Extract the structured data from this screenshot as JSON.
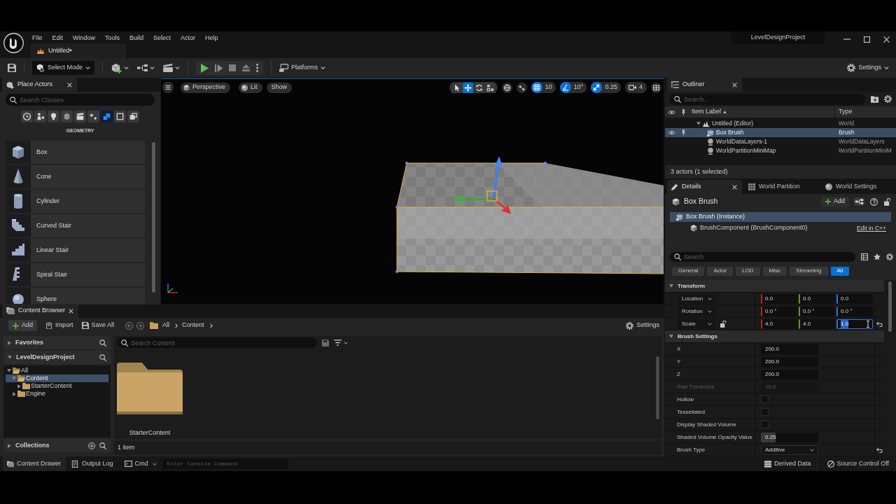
{
  "title_bar": {
    "menu": [
      "File",
      "Edit",
      "Window",
      "Tools",
      "Build",
      "Select",
      "Actor",
      "Help"
    ],
    "document_tab": "Untitled•",
    "project": "LevelDesignProject"
  },
  "toolbar": {
    "mode": "Select Mode",
    "platforms": "Platforms",
    "settings": "Settings"
  },
  "place_actors": {
    "title": "Place Actors",
    "search": {
      "placeholder": "Search Classes"
    },
    "categories": [
      {
        "kind": "recent",
        "selected": false
      },
      {
        "kind": "basic",
        "selected": false
      },
      {
        "kind": "lights",
        "selected": false
      },
      {
        "kind": "shapes",
        "selected": false
      },
      {
        "kind": "cinematic",
        "selected": false
      },
      {
        "kind": "effects",
        "selected": false
      },
      {
        "kind": "geometry",
        "selected": true
      },
      {
        "kind": "volumes",
        "selected": false
      },
      {
        "kind": "all_classes",
        "selected": false
      }
    ],
    "category_title": "GEOMETRY",
    "items": [
      {
        "kind": "box",
        "label": "Box"
      },
      {
        "kind": "cone",
        "label": "Cone"
      },
      {
        "kind": "cylinder",
        "label": "Cylinder"
      },
      {
        "kind": "curved_stair",
        "label": "Curved Stair"
      },
      {
        "kind": "linear_stair",
        "label": "Linear Stair"
      },
      {
        "kind": "spiral_stair",
        "label": "Spiral Stair"
      },
      {
        "kind": "sphere",
        "label": "Sphere"
      }
    ]
  },
  "viewport": {
    "view": "Perspective",
    "lighting": "Lit",
    "show": "Show",
    "tools": [
      {
        "kind": "select",
        "selected": false
      },
      {
        "kind": "translate",
        "selected": true
      },
      {
        "kind": "rotate",
        "selected": false
      },
      {
        "kind": "scale",
        "selected": false
      }
    ],
    "snaps": [
      {
        "kind": "grid",
        "on": true,
        "value": "10"
      },
      {
        "kind": "angle",
        "on": true,
        "value": "10°"
      },
      {
        "kind": "scale",
        "on": true,
        "value": "0.25"
      }
    ],
    "camera_speed": "4"
  },
  "content_browser": {
    "title": "Content Browser",
    "actions": [
      {
        "kind": "add",
        "label": "Add"
      },
      {
        "kind": "import",
        "label": "Import"
      },
      {
        "kind": "save_all",
        "label": "Save All"
      }
    ],
    "path": [
      "All",
      "Content"
    ],
    "settings": "Settings",
    "favorites": "Favorites",
    "project": "LevelDesignProject",
    "tree": [
      {
        "label": "All",
        "expanded": true,
        "selected": false,
        "children": [
          {
            "label": "Content",
            "expanded": true,
            "selected": true,
            "children": [
              {
                "label": "StarterContent",
                "expanded": false,
                "selected": false
              }
            ]
          },
          {
            "label": "Engine",
            "expanded": false,
            "selected": false
          }
        ]
      }
    ],
    "collections": "Collections",
    "search": {
      "placeholder": "Search Content"
    },
    "assets": [
      {
        "kind": "folder",
        "label": "StarterContent"
      }
    ],
    "item_count": "1 item"
  },
  "outliner": {
    "title": "Outliner",
    "search": {
      "placeholder": "Search..."
    },
    "columns": [
      {
        "label": "Item Label",
        "sorted": true
      },
      {
        "label": "Type",
        "sorted": false
      }
    ],
    "rows": [
      {
        "kind": "world",
        "label": "Untitled (Editor)",
        "type": "World",
        "selected": false,
        "expanded": true,
        "children": [
          {
            "kind": "brush",
            "label": "Box Brush",
            "type": "Brush",
            "selected": true
          },
          {
            "kind": "info",
            "label": "WorldDataLayers-1",
            "type": "WorldDataLayers",
            "selected": false
          },
          {
            "kind": "info",
            "label": "WorldPartitionMiniMap",
            "type": "WorldPartitionMiniM",
            "selected": false
          }
        ]
      }
    ],
    "summary": "3 actors (1 selected)"
  },
  "details": {
    "tabs": [
      {
        "kind": "details",
        "label": "Details",
        "selected": true
      },
      {
        "kind": "world_partition",
        "label": "World Partition",
        "selected": false
      },
      {
        "kind": "world_settings",
        "label": "World Settings",
        "selected": false
      }
    ],
    "actor": "Box Brush",
    "add": "Add",
    "components": [
      {
        "label": "Box Brush (Instance)",
        "selected": true,
        "children": [
          {
            "label": "BrushComponent (BrushComponent0)",
            "selected": false,
            "link": "Edit in C++"
          }
        ]
      }
    ],
    "search": {
      "placeholder": "Search"
    },
    "filters": [
      {
        "label": "General",
        "selected": false
      },
      {
        "label": "Actor",
        "selected": false
      },
      {
        "label": "LOD",
        "selected": false
      },
      {
        "label": "Misc",
        "selected": false
      },
      {
        "label": "Streaming",
        "selected": false
      },
      {
        "label": "All",
        "selected": true
      }
    ],
    "sections": [
      {
        "title": "Transform",
        "expanded": true,
        "rows": [
          {
            "kind": "vector",
            "label": "Location",
            "disabled": false,
            "reset": false,
            "fields": [
              {
                "value": "0.0",
                "focused": false
              },
              {
                "value": "0.0",
                "focused": false
              },
              {
                "value": "0.0",
                "focused": false
              }
            ]
          },
          {
            "kind": "vector",
            "label": "Rotation",
            "disabled": false,
            "reset": false,
            "fields": [
              {
                "value": "0.0 °",
                "focused": false
              },
              {
                "value": "0.0 °",
                "focused": false
              },
              {
                "value": "0.0 °",
                "focused": false
              }
            ]
          },
          {
            "kind": "vector",
            "label": "Scale",
            "locked": false,
            "disabled": false,
            "reset": true,
            "fields": [
              {
                "value": "4.0",
                "focused": false
              },
              {
                "value": "4.0",
                "focused": false
              },
              {
                "value": "1.0",
                "focused": true
              }
            ]
          }
        ]
      },
      {
        "title": "Brush Settings",
        "expanded": true,
        "rows": [
          {
            "kind": "number",
            "label": "X",
            "value": "200.0",
            "disabled": false,
            "reset": false
          },
          {
            "kind": "number",
            "label": "Y",
            "value": "200.0",
            "disabled": false,
            "reset": false
          },
          {
            "kind": "number",
            "label": "Z",
            "value": "200.0",
            "disabled": false,
            "reset": false
          },
          {
            "kind": "number",
            "label": "Wall Thickness",
            "value": "10.0",
            "disabled": true,
            "reset": false
          },
          {
            "kind": "checkbox",
            "label": "Hollow",
            "checked": false,
            "disabled": false,
            "reset": false
          },
          {
            "kind": "checkbox",
            "label": "Tessellated",
            "checked": false,
            "disabled": false,
            "reset": false
          },
          {
            "kind": "checkbox",
            "label": "Display Shaded Volume",
            "checked": false,
            "disabled": false,
            "reset": false
          },
          {
            "kind": "slider",
            "label": "Shaded Volume Opacity Value",
            "value": "0.25",
            "level": 0.25,
            "disabled": false,
            "reset": false
          },
          {
            "kind": "dropdown",
            "label": "Brush Type",
            "value": "Additive",
            "disabled": false,
            "reset": true
          }
        ]
      }
    ]
  },
  "status_bar": {
    "left": [
      {
        "kind": "drawer",
        "label": "Content Drawer"
      },
      {
        "kind": "log",
        "label": "Output Log"
      }
    ],
    "cmd": "Cmd",
    "console": {
      "placeholder": "Enter Console Command"
    },
    "right": [
      {
        "kind": "derived_data",
        "label": "Derived Data"
      },
      {
        "kind": "source_control",
        "label": "Source Control Off"
      }
    ]
  }
}
